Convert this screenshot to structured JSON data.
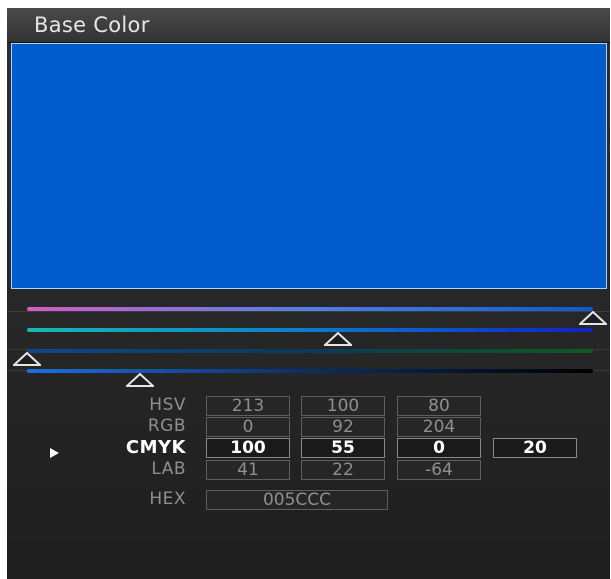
{
  "panel": {
    "title": "Base Color"
  },
  "swatch": {
    "color": "#005CCC"
  },
  "sliders": [
    {
      "id": "hue",
      "gradient": [
        "#d65cc6",
        "#4f7fe8",
        "#0a5ccf"
      ],
      "value": 1.0
    },
    {
      "id": "saturation",
      "gradient": [
        "#17b9b0",
        "#0a7cd0",
        "#1022c8"
      ],
      "value": 0.55
    },
    {
      "id": "value",
      "gradient": [
        "#0a4a8a",
        "#0b3a58",
        "#0d5a20"
      ],
      "value": 0.0
    },
    {
      "id": "key",
      "gradient": [
        "#1b6fe0",
        "#0a2e66",
        "#000000"
      ],
      "value": 0.2
    }
  ],
  "color_values": {
    "rows": [
      {
        "label": "HSV",
        "values": [
          "213",
          "100",
          "80"
        ],
        "active": false
      },
      {
        "label": "RGB",
        "values": [
          "0",
          "92",
          "204"
        ],
        "active": false
      },
      {
        "label": "CMYK",
        "values": [
          "100",
          "55",
          "0",
          "20"
        ],
        "active": true
      },
      {
        "label": "LAB",
        "values": [
          "41",
          "22",
          "-64"
        ],
        "active": false
      }
    ],
    "hex_label": "HEX",
    "hex_value": "005CCC"
  },
  "icons": {
    "active_marker": "play-triangle-icon",
    "slider_thumb": "triangle-up-outline-icon"
  }
}
